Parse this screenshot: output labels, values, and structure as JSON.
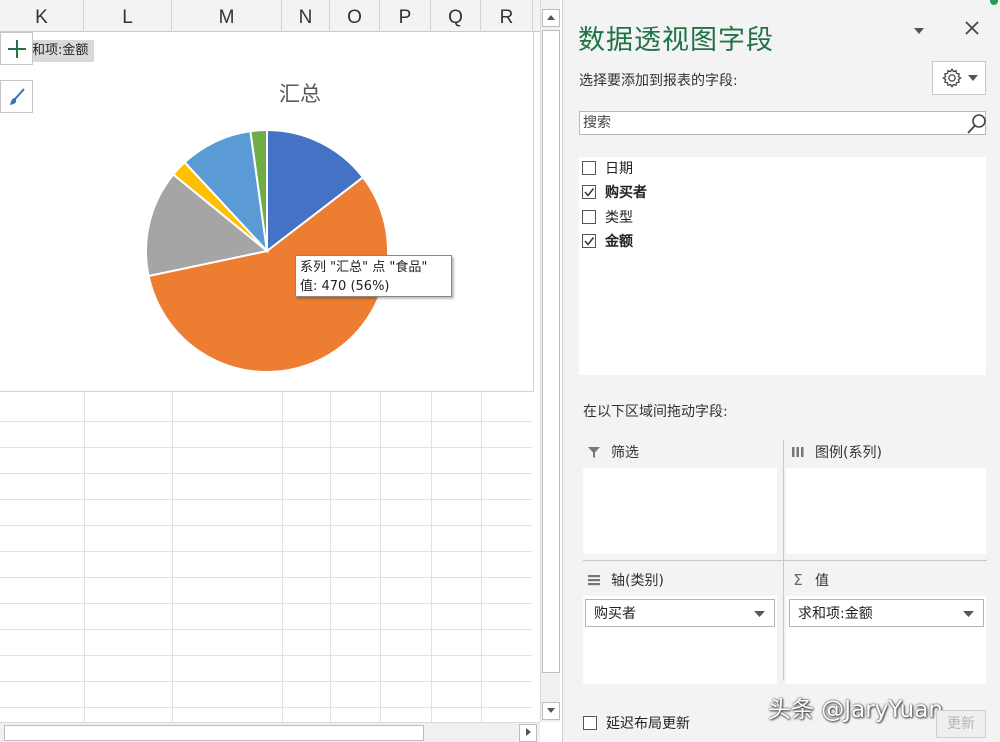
{
  "sheet": {
    "columns": [
      "K",
      "L",
      "M",
      "N",
      "O",
      "P",
      "Q",
      "R"
    ]
  },
  "chart": {
    "field_button": "和项:金额",
    "side_buttons": [
      "plus-icon",
      "brush-icon"
    ],
    "tooltip": {
      "line1": "系列 \"汇总\" 点 \"食品\"",
      "line2": "值: 470 (56%)"
    }
  },
  "chart_data": {
    "type": "pie",
    "title": "汇总",
    "series": [
      {
        "values": [
          120,
          470,
          117,
          18,
          80,
          18
        ]
      }
    ],
    "colors": [
      "#4472c4",
      "#ed7d31",
      "#a5a5a5",
      "#ffc000",
      "#5b9bd5",
      "#70ad47"
    ],
    "start_angle_deg": 0,
    "direction": "clockwise",
    "highlighted_slice": 1
  },
  "panel": {
    "title": "数据透视图字段",
    "menu_icon": "dropdown-triangle-icon",
    "close_icon": "close-icon",
    "choose_label": "选择要添加到报表的字段:",
    "gear_icon": "gear-icon",
    "search": {
      "placeholder": "搜索"
    },
    "fields": [
      {
        "label": "日期",
        "checked": false,
        "bold": false
      },
      {
        "label": "购买者",
        "checked": true,
        "bold": true
      },
      {
        "label": "类型",
        "checked": false,
        "bold": false
      },
      {
        "label": "金额",
        "checked": true,
        "bold": true
      }
    ],
    "drag_label": "在以下区域间拖动字段:",
    "areas": {
      "filter": {
        "label": "筛选",
        "icon": "filter-icon"
      },
      "legend": {
        "label": "图例(系列)",
        "icon": "columns-icon"
      },
      "axis": {
        "label": "轴(类别)",
        "icon": "rows-icon",
        "item": "购买者"
      },
      "values": {
        "label": "值",
        "icon": "sigma-icon",
        "item": "求和项:金额"
      }
    },
    "defer_label": "延迟布局更新",
    "update_label": "更新",
    "watermark": "头条 @JaryYuan"
  },
  "colors": {
    "accent_green": "#217346"
  }
}
